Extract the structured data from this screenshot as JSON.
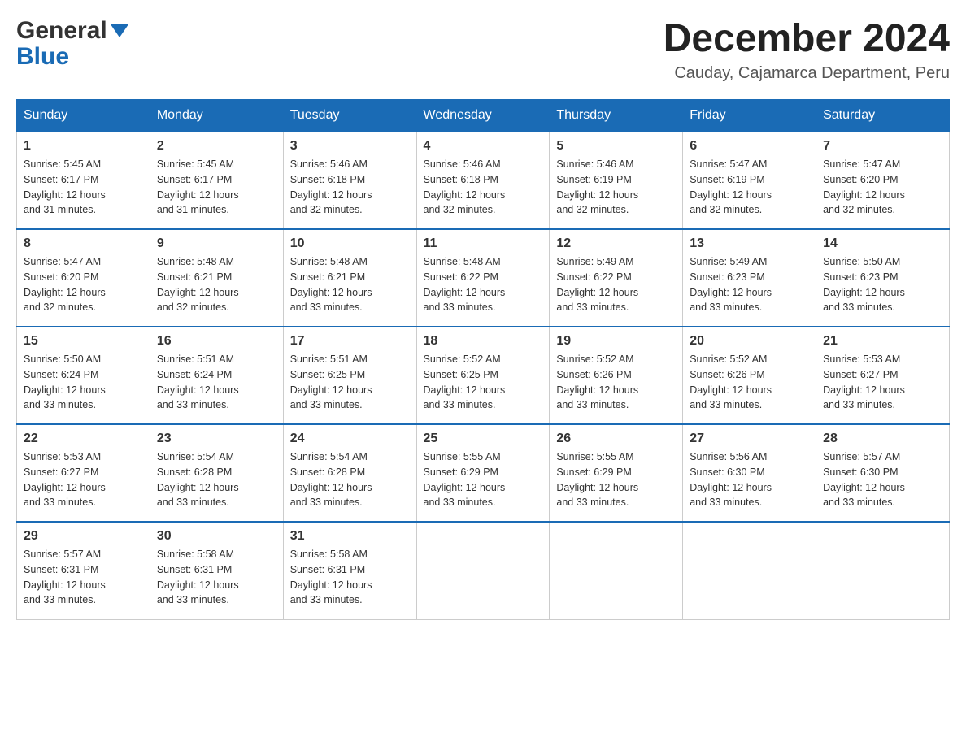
{
  "header": {
    "logo": {
      "part1": "General",
      "part2": "Blue"
    },
    "title": "December 2024",
    "subtitle": "Cauday, Cajamarca Department, Peru"
  },
  "calendar": {
    "days_of_week": [
      "Sunday",
      "Monday",
      "Tuesday",
      "Wednesday",
      "Thursday",
      "Friday",
      "Saturday"
    ],
    "weeks": [
      [
        {
          "day": "1",
          "sunrise": "5:45 AM",
          "sunset": "6:17 PM",
          "daylight": "12 hours and 31 minutes."
        },
        {
          "day": "2",
          "sunrise": "5:45 AM",
          "sunset": "6:17 PM",
          "daylight": "12 hours and 31 minutes."
        },
        {
          "day": "3",
          "sunrise": "5:46 AM",
          "sunset": "6:18 PM",
          "daylight": "12 hours and 32 minutes."
        },
        {
          "day": "4",
          "sunrise": "5:46 AM",
          "sunset": "6:18 PM",
          "daylight": "12 hours and 32 minutes."
        },
        {
          "day": "5",
          "sunrise": "5:46 AM",
          "sunset": "6:19 PM",
          "daylight": "12 hours and 32 minutes."
        },
        {
          "day": "6",
          "sunrise": "5:47 AM",
          "sunset": "6:19 PM",
          "daylight": "12 hours and 32 minutes."
        },
        {
          "day": "7",
          "sunrise": "5:47 AM",
          "sunset": "6:20 PM",
          "daylight": "12 hours and 32 minutes."
        }
      ],
      [
        {
          "day": "8",
          "sunrise": "5:47 AM",
          "sunset": "6:20 PM",
          "daylight": "12 hours and 32 minutes."
        },
        {
          "day": "9",
          "sunrise": "5:48 AM",
          "sunset": "6:21 PM",
          "daylight": "12 hours and 32 minutes."
        },
        {
          "day": "10",
          "sunrise": "5:48 AM",
          "sunset": "6:21 PM",
          "daylight": "12 hours and 33 minutes."
        },
        {
          "day": "11",
          "sunrise": "5:48 AM",
          "sunset": "6:22 PM",
          "daylight": "12 hours and 33 minutes."
        },
        {
          "day": "12",
          "sunrise": "5:49 AM",
          "sunset": "6:22 PM",
          "daylight": "12 hours and 33 minutes."
        },
        {
          "day": "13",
          "sunrise": "5:49 AM",
          "sunset": "6:23 PM",
          "daylight": "12 hours and 33 minutes."
        },
        {
          "day": "14",
          "sunrise": "5:50 AM",
          "sunset": "6:23 PM",
          "daylight": "12 hours and 33 minutes."
        }
      ],
      [
        {
          "day": "15",
          "sunrise": "5:50 AM",
          "sunset": "6:24 PM",
          "daylight": "12 hours and 33 minutes."
        },
        {
          "day": "16",
          "sunrise": "5:51 AM",
          "sunset": "6:24 PM",
          "daylight": "12 hours and 33 minutes."
        },
        {
          "day": "17",
          "sunrise": "5:51 AM",
          "sunset": "6:25 PM",
          "daylight": "12 hours and 33 minutes."
        },
        {
          "day": "18",
          "sunrise": "5:52 AM",
          "sunset": "6:25 PM",
          "daylight": "12 hours and 33 minutes."
        },
        {
          "day": "19",
          "sunrise": "5:52 AM",
          "sunset": "6:26 PM",
          "daylight": "12 hours and 33 minutes."
        },
        {
          "day": "20",
          "sunrise": "5:52 AM",
          "sunset": "6:26 PM",
          "daylight": "12 hours and 33 minutes."
        },
        {
          "day": "21",
          "sunrise": "5:53 AM",
          "sunset": "6:27 PM",
          "daylight": "12 hours and 33 minutes."
        }
      ],
      [
        {
          "day": "22",
          "sunrise": "5:53 AM",
          "sunset": "6:27 PM",
          "daylight": "12 hours and 33 minutes."
        },
        {
          "day": "23",
          "sunrise": "5:54 AM",
          "sunset": "6:28 PM",
          "daylight": "12 hours and 33 minutes."
        },
        {
          "day": "24",
          "sunrise": "5:54 AM",
          "sunset": "6:28 PM",
          "daylight": "12 hours and 33 minutes."
        },
        {
          "day": "25",
          "sunrise": "5:55 AM",
          "sunset": "6:29 PM",
          "daylight": "12 hours and 33 minutes."
        },
        {
          "day": "26",
          "sunrise": "5:55 AM",
          "sunset": "6:29 PM",
          "daylight": "12 hours and 33 minutes."
        },
        {
          "day": "27",
          "sunrise": "5:56 AM",
          "sunset": "6:30 PM",
          "daylight": "12 hours and 33 minutes."
        },
        {
          "day": "28",
          "sunrise": "5:57 AM",
          "sunset": "6:30 PM",
          "daylight": "12 hours and 33 minutes."
        }
      ],
      [
        {
          "day": "29",
          "sunrise": "5:57 AM",
          "sunset": "6:31 PM",
          "daylight": "12 hours and 33 minutes."
        },
        {
          "day": "30",
          "sunrise": "5:58 AM",
          "sunset": "6:31 PM",
          "daylight": "12 hours and 33 minutes."
        },
        {
          "day": "31",
          "sunrise": "5:58 AM",
          "sunset": "6:31 PM",
          "daylight": "12 hours and 33 minutes."
        },
        null,
        null,
        null,
        null
      ]
    ],
    "labels": {
      "sunrise": "Sunrise:",
      "sunset": "Sunset:",
      "daylight": "Daylight:"
    }
  }
}
